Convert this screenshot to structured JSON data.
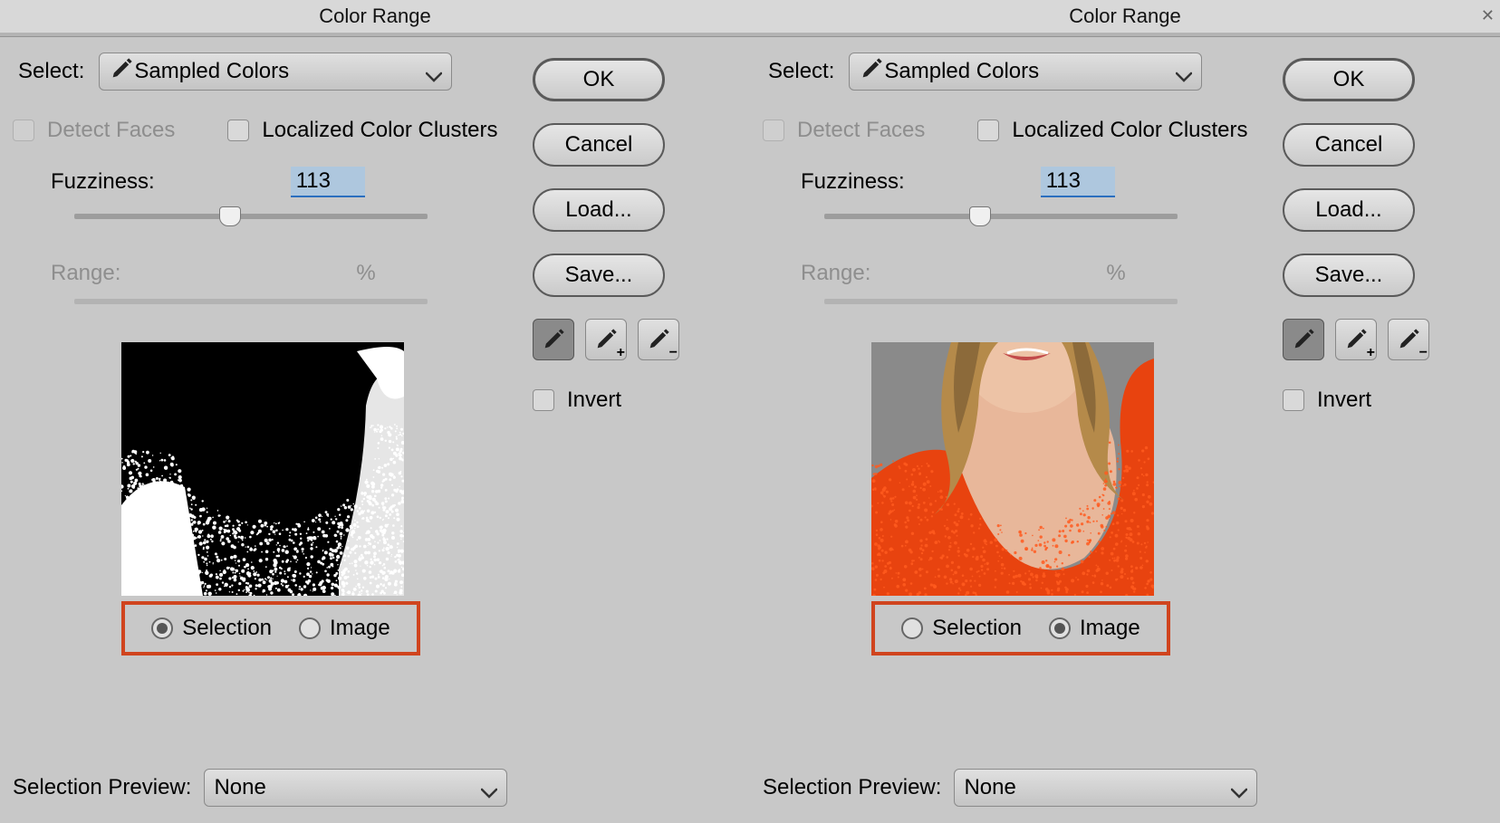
{
  "dialogs": [
    {
      "title": "Color Range",
      "select_label": "Select:",
      "select_value": "Sampled Colors",
      "detect_faces": {
        "label": "Detect Faces",
        "checked": false,
        "enabled": false
      },
      "localized": {
        "label": "Localized Color Clusters",
        "checked": false,
        "enabled": true
      },
      "fuzziness": {
        "label": "Fuzziness:",
        "value": "113",
        "pct": 44
      },
      "range": {
        "label": "Range:",
        "unit": "%",
        "enabled": false
      },
      "preview_mode": {
        "selection_label": "Selection",
        "image_label": "Image",
        "active": "selection"
      },
      "selection_preview": {
        "label": "Selection Preview:",
        "value": "None"
      },
      "buttons": {
        "ok": "OK",
        "cancel": "Cancel",
        "load": "Load...",
        "save": "Save..."
      },
      "eyedroppers": {
        "sample": "eyedropper",
        "add": "eyedropper-add",
        "sub": "eyedropper-subtract",
        "active": "sample"
      },
      "invert": {
        "label": "Invert",
        "checked": false
      },
      "preview_kind": "mask"
    },
    {
      "title": "Color Range",
      "select_label": "Select:",
      "select_value": "Sampled Colors",
      "detect_faces": {
        "label": "Detect Faces",
        "checked": false,
        "enabled": false
      },
      "localized": {
        "label": "Localized Color Clusters",
        "checked": false,
        "enabled": true
      },
      "fuzziness": {
        "label": "Fuzziness:",
        "value": "113",
        "pct": 44
      },
      "range": {
        "label": "Range:",
        "unit": "%",
        "enabled": false
      },
      "preview_mode": {
        "selection_label": "Selection",
        "image_label": "Image",
        "active": "image"
      },
      "selection_preview": {
        "label": "Selection Preview:",
        "value": "None"
      },
      "buttons": {
        "ok": "OK",
        "cancel": "Cancel",
        "load": "Load...",
        "save": "Save..."
      },
      "eyedroppers": {
        "sample": "eyedropper",
        "add": "eyedropper-add",
        "sub": "eyedropper-subtract",
        "active": "sample"
      },
      "invert": {
        "label": "Invert",
        "checked": false
      },
      "preview_kind": "photo"
    }
  ]
}
